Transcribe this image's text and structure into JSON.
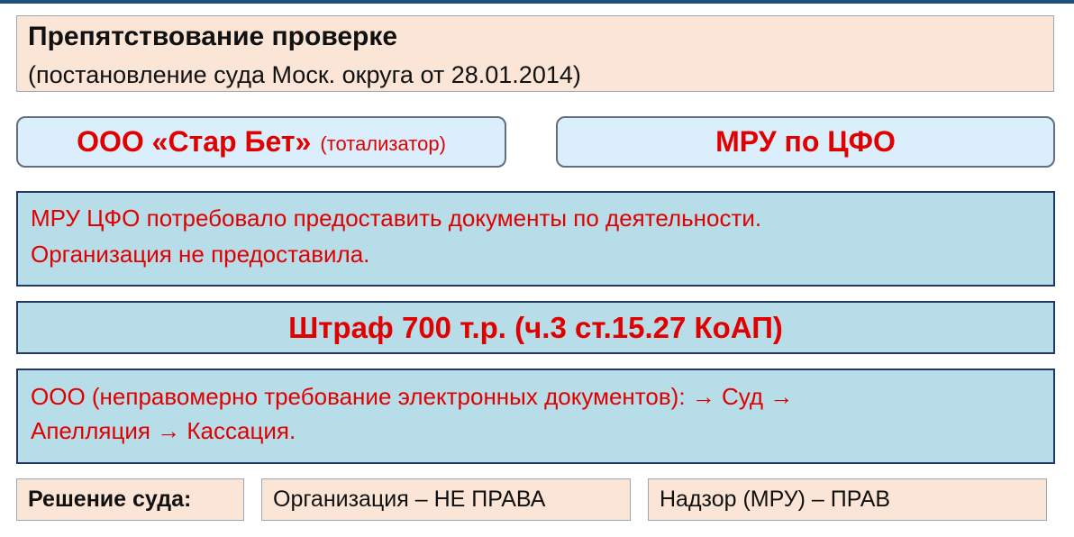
{
  "header": {
    "title": "Препятствование проверке",
    "subtitle": "(постановление суда Моск. округа от 28.01.2014)"
  },
  "parties": {
    "left_main": "ООО «Стар Бет»",
    "left_note": "(тотализатор)",
    "right": "МРУ по ЦФО"
  },
  "facts": {
    "line1": "МРУ ЦФО потребовало предоставить документы по деятельности.",
    "line2": "Организация не предоставила."
  },
  "fine": "Штраф 700 т.р. (ч.3 ст.15.27 КоАП)",
  "appeal": {
    "line1": "ООО (неправомерно требование электронных документов):  → Суд →",
    "line2": "Апелляция → Кассация."
  },
  "decision": {
    "label": "Решение суда:",
    "org": "Организация – НЕ ПРАВА",
    "supervisor": "Надзор (МРУ) – ПРАВ"
  },
  "colors": {
    "accent_red": "#e00000",
    "panel_blue": "#b7dde8",
    "pill_blue": "#daeefb",
    "peach": "#fbe5d6",
    "navy": "#1f3864"
  }
}
